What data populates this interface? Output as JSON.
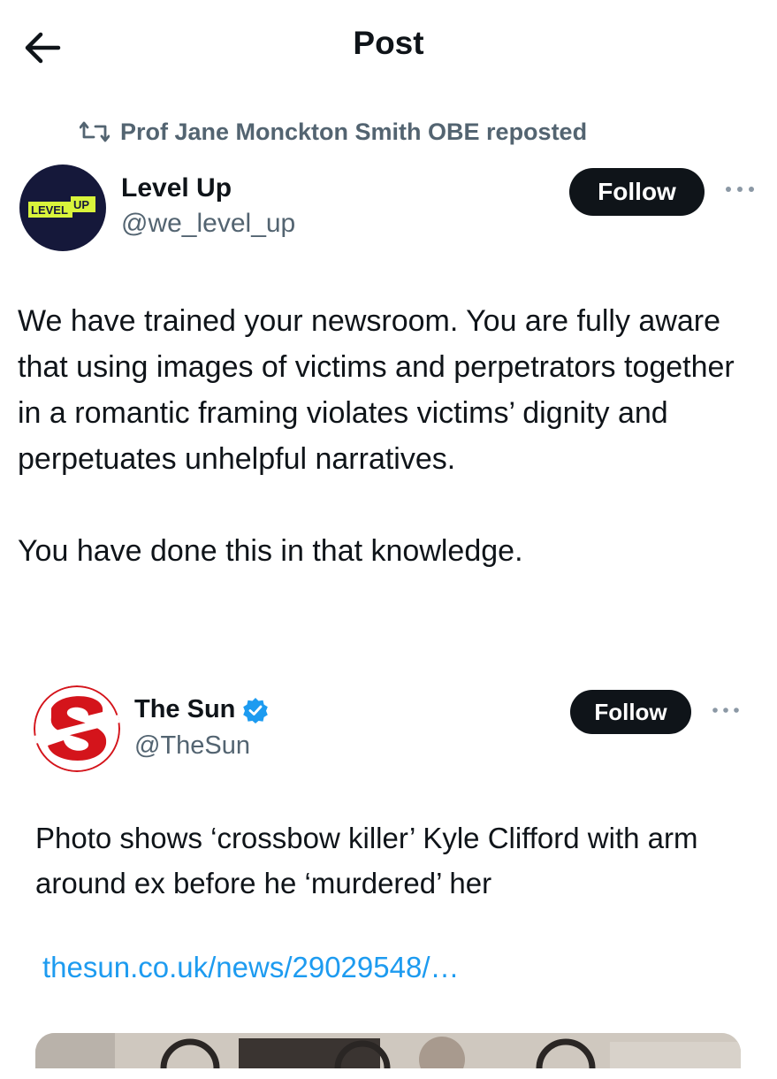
{
  "header": {
    "title": "Post",
    "back_icon": "arrow-left-icon"
  },
  "repost": {
    "icon": "repost-icon",
    "text": "Prof Jane Monckton Smith OBE reposted"
  },
  "author": {
    "name": "Level Up",
    "handle": "@we_level_up",
    "avatar_logo": "LEVEL UP",
    "follow_label": "Follow"
  },
  "tweet": {
    "text": "We have trained your newsroom. You are fully aware that using images of victims and perpetrators together in a romantic framing violates victims’ dignity and perpetuates unhelpful narratives.\n\nYou have done this in that knowledge."
  },
  "quoted": {
    "name": "The Sun",
    "handle": "@TheSun",
    "verified_icon": "verified-badge-icon",
    "follow_label": "Follow",
    "text": "Photo shows ‘crossbow killer’ Kyle Clifford with arm around ex before he ‘murdered’ her",
    "link": "thesun.co.uk/news/29029548/…"
  },
  "colors": {
    "text": "#0f1419",
    "secondary": "#536471",
    "link": "#1d9bf0",
    "button": "#0f1419",
    "levelup_bg": "#15183a",
    "levelup_accent": "#d9f43b",
    "sun_red": "#d4141b"
  }
}
